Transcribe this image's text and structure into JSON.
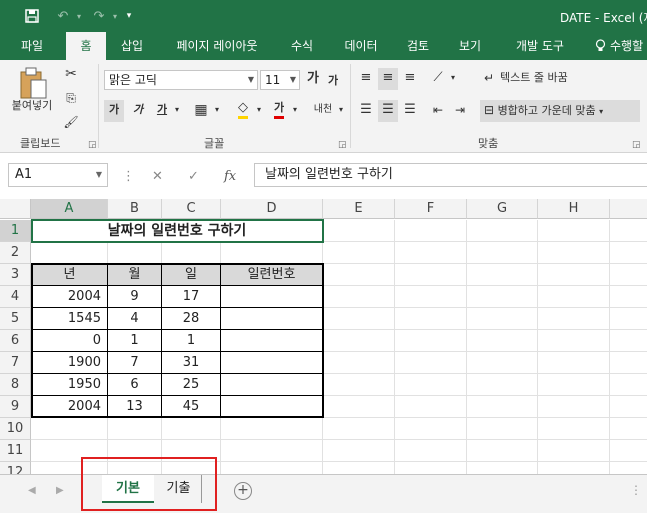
{
  "window": {
    "title": "DATE - Excel (제",
    "save_icon": "save-icon",
    "undo_icon": "undo-icon",
    "redo_icon": "redo-icon"
  },
  "tabs": [
    {
      "label": "파일"
    },
    {
      "label": "홈"
    },
    {
      "label": "삽입"
    },
    {
      "label": "페이지 레이아웃"
    },
    {
      "label": "수식"
    },
    {
      "label": "데이터"
    },
    {
      "label": "검토"
    },
    {
      "label": "보기"
    },
    {
      "label": "개발 도구"
    },
    {
      "label": "수행할"
    }
  ],
  "ribbon": {
    "paste_label": "붙여넣기",
    "clipboard_label": "클립보드",
    "font_name": "맑은 고딕",
    "font_size": "11",
    "font_label": "글꼴",
    "bold": "가",
    "italic": "가",
    "underline": "가",
    "font_color_glyph": "가",
    "wrap_text": "텍스트 줄 바꿈",
    "merge_center": "병합하고 가운데 맞춤",
    "alignment_label": "맞춤",
    "grow": "가",
    "shrink": "가",
    "phonetic": "내천"
  },
  "formula_bar": {
    "name_box": "A1",
    "formula": "날짜의 일련번호 구하기"
  },
  "columns": [
    "A",
    "B",
    "C",
    "D",
    "E",
    "F",
    "G",
    "H"
  ],
  "rows": [
    "1",
    "2",
    "3",
    "4",
    "5",
    "6",
    "7",
    "8",
    "9",
    "10",
    "11",
    "12"
  ],
  "sheet": {
    "title": "날짜의 일련번호 구하기",
    "headers": [
      "년",
      "월",
      "일",
      "일련번호"
    ],
    "data": [
      [
        "2004",
        "9",
        "17",
        ""
      ],
      [
        "1545",
        "4",
        "28",
        ""
      ],
      [
        "0",
        "1",
        "1",
        ""
      ],
      [
        "1900",
        "7",
        "31",
        ""
      ],
      [
        "1950",
        "6",
        "25",
        ""
      ],
      [
        "2004",
        "13",
        "45",
        ""
      ]
    ]
  },
  "sheet_tabs": [
    {
      "label": "기본",
      "active": true
    },
    {
      "label": "기출",
      "active": false
    }
  ],
  "colors": {
    "accent": "#217346",
    "highlight_box": "#e02020"
  }
}
